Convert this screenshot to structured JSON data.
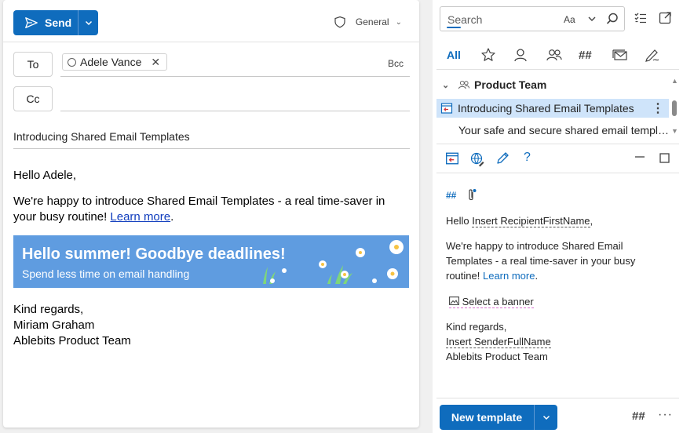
{
  "compose": {
    "send_label": "Send",
    "sensitivity_label": "General",
    "to_label": "To",
    "cc_label": "Cc",
    "bcc_label": "Bcc",
    "recipient": "Adele Vance",
    "subject": "Introducing Shared Email Templates",
    "body": {
      "greeting": "Hello Adele,",
      "paragraph_text": "We're happy to introduce Shared Email Templates - a real time-saver in your busy routine! ",
      "learn_more": "Learn more",
      "paragraph_end": ".",
      "banner_title": "Hello summer! Goodbye deadlines!",
      "banner_subtitle": "Spend less time on email handling",
      "closing": "Kind regards,",
      "signature_name": "Miriam Graham",
      "signature_team": "Ablebits Product Team"
    }
  },
  "addin": {
    "search_placeholder": "Search",
    "search_case_label": "Aa",
    "tab_all_label": "All",
    "folder_name": "Product Team",
    "template_title": "Introducing Shared Email Templates",
    "template_description": "Your safe and secure shared email templa...",
    "preview": {
      "hello": "Hello ",
      "macro_first_name": "Insert RecipientFirstName",
      "comma": ",",
      "paragraph_text": "We're happy to introduce Shared Email Templates - a real time-saver in your busy routine! ",
      "learn_more": "Learn more",
      "period": ".",
      "banner_picker": "Select a banner",
      "closing": "Kind regards,",
      "macro_sender": "Insert SenderFullName",
      "team": "Ablebits Product Team"
    },
    "new_template_label": "New template",
    "more_label": "···",
    "macro_label": "##"
  },
  "colors": {
    "accent": "#0f6cbd",
    "selected_row": "#cfe4fa",
    "banner_bg": "#5f9ce0"
  },
  "icons": [
    "send-icon",
    "shield-icon",
    "chevron-down-icon",
    "close-icon",
    "search-icon",
    "task-list-icon",
    "popout-icon",
    "star-icon",
    "person-icon",
    "people-icon",
    "hashtag-icon",
    "envelope-stack-icon",
    "pen-signature-icon",
    "template-icon",
    "globe-edit-icon",
    "pencil-icon",
    "help-icon",
    "minimize-icon",
    "maximize-icon",
    "attach-icon",
    "image-icon"
  ]
}
